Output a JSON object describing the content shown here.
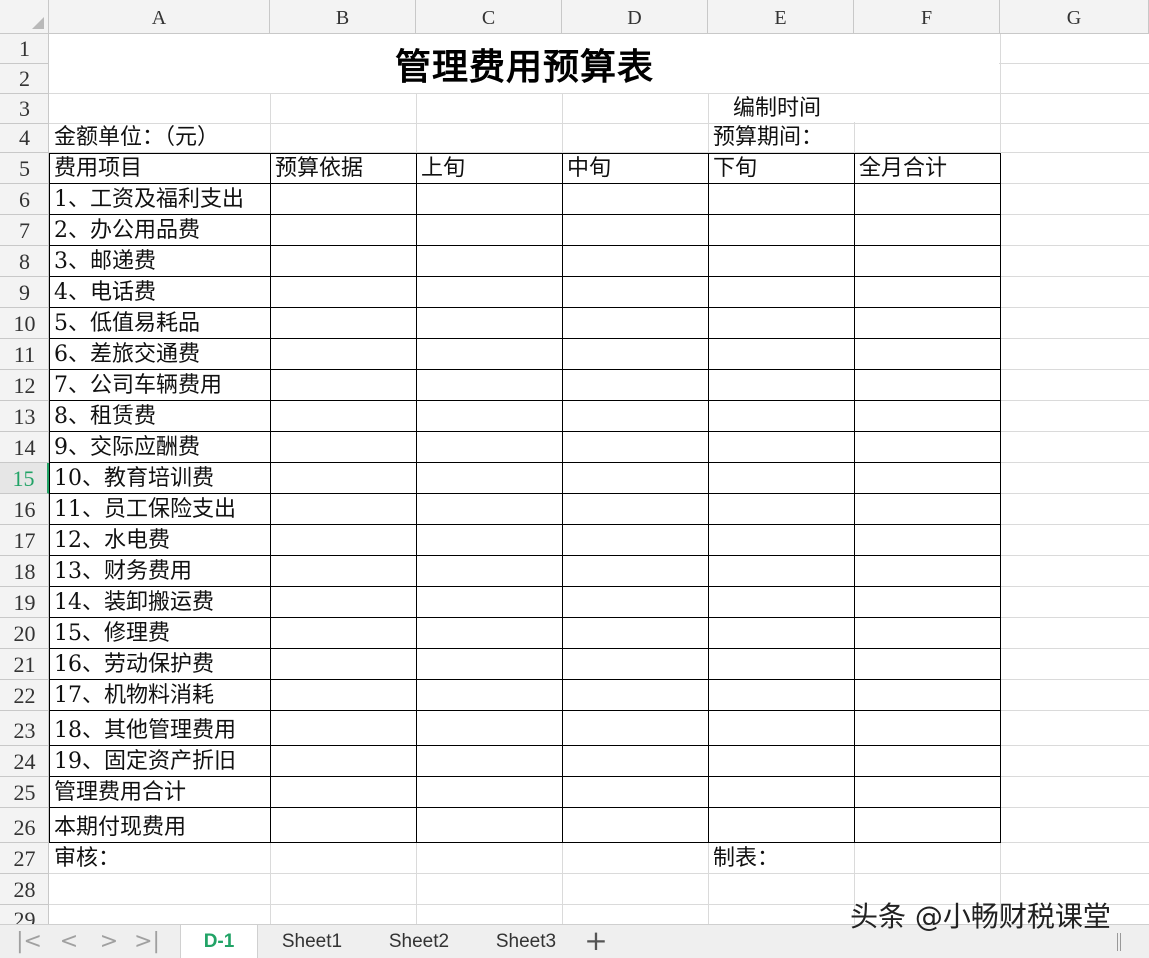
{
  "columns": [
    "A",
    "B",
    "C",
    "D",
    "E",
    "F",
    "G"
  ],
  "rows": [
    "1",
    "2",
    "3",
    "4",
    "5",
    "6",
    "7",
    "8",
    "9",
    "10",
    "11",
    "12",
    "13",
    "14",
    "15",
    "16",
    "17",
    "18",
    "19",
    "20",
    "21",
    "22",
    "23",
    "24",
    "25",
    "26",
    "27",
    "28",
    "29"
  ],
  "active_row": "15",
  "title": "管理费用预算表",
  "compile_time_label": "编制时间",
  "amount_unit_label": "金额单位：（元）",
  "budget_period_label": "预算期间：",
  "headers": [
    "费用项目",
    "预算依据",
    "上旬",
    "中旬",
    "下旬",
    "全月合计"
  ],
  "items": [
    "1、工资及福利支出",
    "2、办公用品费",
    "3、邮递费",
    "4、电话费",
    "5、低值易耗品",
    "6、差旅交通费",
    "7、公司车辆费用",
    "8、租赁费",
    "9、交际应酬费",
    "10、教育培训费",
    "11、员工保险支出",
    "12、水电费",
    "13、财务费用",
    "14、装卸搬运费",
    "15、修理费",
    "16、劳动保护费",
    "17、机物料消耗",
    "18、其他管理费用",
    "19、固定资产折旧",
    "管理费用合计",
    "本期付现费用"
  ],
  "reviewer_label": "审核：",
  "preparer_label": "制表：",
  "sheet_tabs": [
    "D-1",
    "Sheet1",
    "Sheet2",
    "Sheet3"
  ],
  "active_sheet": "D-1",
  "nav_icons": [
    "first-sheet-icon",
    "prev-sheet-icon",
    "next-sheet-icon",
    "last-sheet-icon"
  ],
  "add_sheet_icon": "plus-icon",
  "watermark": "头条 @小畅财税课堂",
  "accent_color": "#21a366"
}
